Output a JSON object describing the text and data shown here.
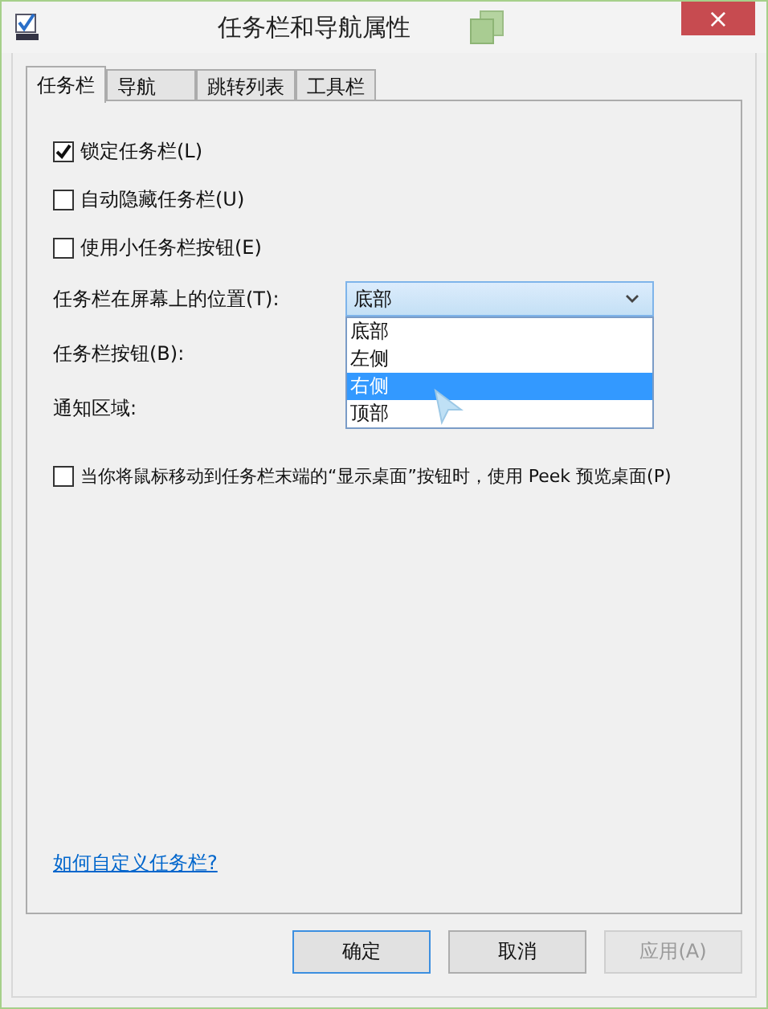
{
  "window": {
    "title": "任务栏和导航属性",
    "close": "×"
  },
  "tabs": [
    {
      "label": "任务栏",
      "selected": true
    },
    {
      "label": "导航",
      "selected": false
    },
    {
      "label": "跳转列表",
      "selected": false
    },
    {
      "label": "工具栏",
      "selected": false
    }
  ],
  "checkboxes": [
    {
      "label": "锁定任务栏(L)",
      "checked": true
    },
    {
      "label": "自动隐藏任务栏(U)",
      "checked": false
    },
    {
      "label": "使用小任务栏按钮(E)",
      "checked": false
    }
  ],
  "position": {
    "label": "任务栏在屏幕上的位置(T):",
    "value": "底部",
    "expanded": true,
    "options": [
      {
        "label": "底部",
        "highlighted": false
      },
      {
        "label": "左侧",
        "highlighted": false
      },
      {
        "label": "右侧",
        "highlighted": true
      },
      {
        "label": "顶部",
        "highlighted": false
      }
    ]
  },
  "taskbar_buttons": {
    "label": "任务栏按钮(B):"
  },
  "notification_area": {
    "label": "通知区域:"
  },
  "peek": {
    "label": "当你将鼠标移动到任务栏末端的“显示桌面”按钮时，使用 Peek 预览桌面(P)",
    "checked": false
  },
  "help_link": "如何自定义任务栏?",
  "buttons": [
    {
      "label": "确定",
      "kind": "default",
      "disabled": false
    },
    {
      "label": "取消",
      "kind": "normal",
      "disabled": false
    },
    {
      "label": "应用(A)",
      "kind": "normal",
      "disabled": true
    }
  ]
}
